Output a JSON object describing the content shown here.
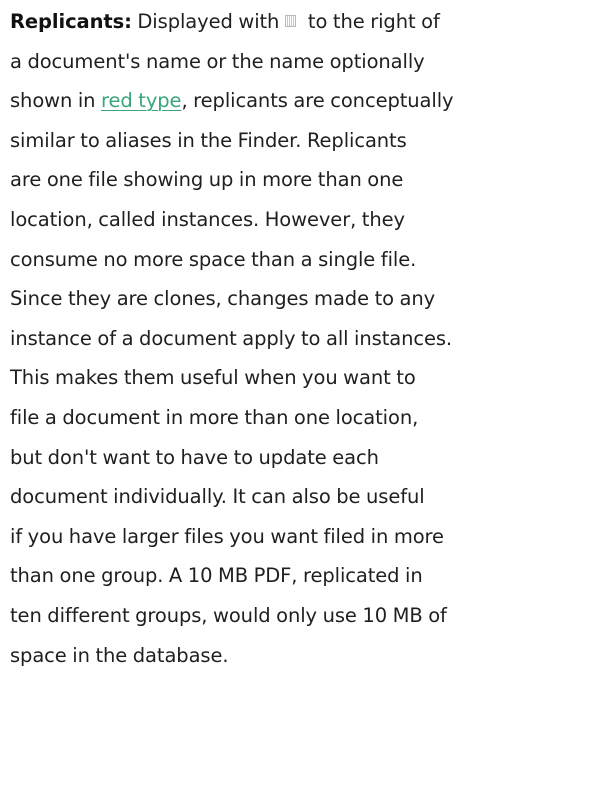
{
  "document": {
    "lines": [
      {
        "term": "Replicants:",
        "pre_icon": " Displayed with",
        "post_icon": " to the right of"
      },
      {
        "text": "a document's name or the name optionally"
      },
      {
        "pre_link": "shown in ",
        "link": "red type",
        "post_link": ", replicants are conceptually"
      },
      {
        "text": "similar to aliases in the Finder. Replicants"
      },
      {
        "text": "are one file showing up in more than one"
      },
      {
        "text": "location, called instances. However, they"
      },
      {
        "text": "consume no more space than a single file."
      },
      {
        "text": "Since they are clones, changes made to any"
      },
      {
        "text": "instance of a document apply to all instances."
      },
      {
        "text": "This makes them useful when you want to"
      },
      {
        "text": "file a document in more than one location,"
      },
      {
        "text": "but don't want to have to update each"
      },
      {
        "text": "document individually. It can also be useful"
      },
      {
        "text": "if you have larger files you want filed in more"
      },
      {
        "text": "than one group. A 10 MB PDF, replicated in"
      },
      {
        "text": "ten different groups, would only use 10 MB of"
      },
      {
        "text": "space in the database."
      }
    ],
    "icon": "replicant-icon",
    "colors": {
      "text": "#1f1f1f",
      "link": "#3aa57a"
    }
  }
}
